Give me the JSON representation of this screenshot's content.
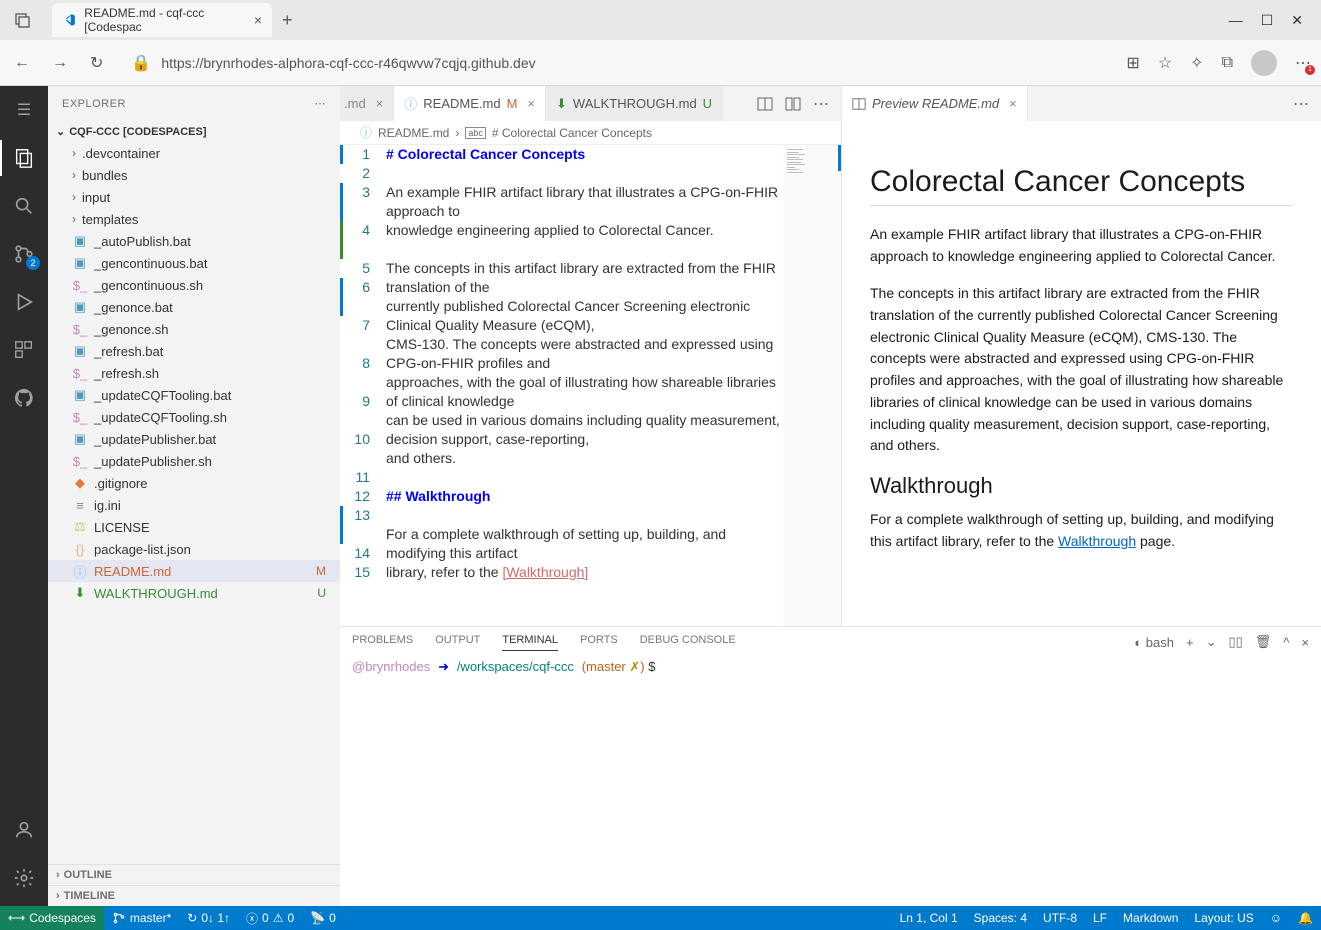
{
  "browser": {
    "tab_title": "README.md - cqf-ccc [Codespac",
    "url": "https://brynrhodes-alphora-cqf-ccc-r46qwvw7cqjq.github.dev",
    "more_badge": "1"
  },
  "explorer": {
    "title": "EXPLORER",
    "root": "CQF-CCC [CODESPACES]",
    "folders": [
      {
        "name": ".devcontainer"
      },
      {
        "name": "bundles"
      },
      {
        "name": "input"
      },
      {
        "name": "templates"
      }
    ],
    "files": [
      {
        "name": "_autoPublish.bat",
        "icon": "bat"
      },
      {
        "name": "_gencontinuous.bat",
        "icon": "bat"
      },
      {
        "name": "_gencontinuous.sh",
        "icon": "sh"
      },
      {
        "name": "_genonce.bat",
        "icon": "bat"
      },
      {
        "name": "_genonce.sh",
        "icon": "sh"
      },
      {
        "name": "_refresh.bat",
        "icon": "bat"
      },
      {
        "name": "_refresh.sh",
        "icon": "sh"
      },
      {
        "name": "_updateCQFTooling.bat",
        "icon": "bat"
      },
      {
        "name": "_updateCQFTooling.sh",
        "icon": "sh"
      },
      {
        "name": "_updatePublisher.bat",
        "icon": "bat"
      },
      {
        "name": "_updatePublisher.sh",
        "icon": "sh"
      },
      {
        "name": ".gitignore",
        "icon": "git"
      },
      {
        "name": "ig.ini",
        "icon": "ini"
      },
      {
        "name": "LICENSE",
        "icon": "license"
      },
      {
        "name": "package-list.json",
        "icon": "json"
      },
      {
        "name": "README.md",
        "icon": "info",
        "status": "M",
        "highlighted": true
      },
      {
        "name": "WALKTHROUGH.md",
        "icon": "walk",
        "status": "U"
      }
    ],
    "outline": "OUTLINE",
    "timeline": "TIMELINE"
  },
  "tabs": {
    "partial": ".md",
    "t1": {
      "label": "README.md",
      "mod": "M"
    },
    "t2": {
      "label": "WALKTHROUGH.md",
      "mod": "U"
    },
    "preview": {
      "label": "Preview README.md"
    }
  },
  "breadcrumb": {
    "file": "README.md",
    "section": "# Colorectal Cancer Concepts"
  },
  "editor_lines": [
    {
      "n": "1",
      "cls": "md-h1",
      "text": "# Colorectal Cancer Concepts",
      "mark": "changed"
    },
    {
      "n": "2",
      "text": ""
    },
    {
      "n": "3",
      "text": "An example FHIR artifact library that illustrates a CPG-on-FHIR approach to",
      "mark": "changed"
    },
    {
      "n": "4",
      "text": "knowledge engineering applied to Colorectal Cancer.",
      "mark": "added"
    },
    {
      "n": "5",
      "text": ""
    },
    {
      "n": "6",
      "text": "The concepts in this artifact library are extracted from the FHIR translation of the",
      "mark": "changed"
    },
    {
      "n": "7",
      "text": "currently published Colorectal Cancer Screening electronic Clinical Quality Measure (eCQM),"
    },
    {
      "n": "8",
      "text": "CMS-130. The concepts were abstracted and expressed using CPG-on-FHIR profiles and"
    },
    {
      "n": "9",
      "text": "approaches, with the goal of illustrating how shareable libraries of clinical knowledge"
    },
    {
      "n": "10",
      "text": "can be used in various domains including quality measurement, decision support, case-reporting,"
    },
    {
      "n": "11",
      "text": "and others."
    },
    {
      "n": "12",
      "text": ""
    },
    {
      "n": "13",
      "cls": "md-h2",
      "text": "## Walkthrough",
      "mark": "changed"
    },
    {
      "n": "14",
      "text": ""
    },
    {
      "n": "15",
      "text": "For a complete walkthrough of setting up, building, and modifying this artifact"
    },
    {
      "n": "",
      "text": "library, refer to the ",
      "link": "[Walkthrough]"
    }
  ],
  "preview": {
    "h1": "Colorectal Cancer Concepts",
    "p1": "An example FHIR artifact library that illustrates a CPG-on-FHIR approach to knowledge engineering applied to Colorectal Cancer.",
    "p2": "The concepts in this artifact library are extracted from the FHIR translation of the currently published Colorectal Cancer Screening electronic Clinical Quality Measure (eCQM), CMS-130. The concepts were abstracted and expressed using CPG-on-FHIR profiles and approaches, with the goal of illustrating how shareable libraries of clinical knowledge can be used in various domains including quality measurement, decision support, case-reporting, and others.",
    "h2": "Walkthrough",
    "p3a": "For a complete walkthrough of setting up, building, and modifying this artifact library, refer to the ",
    "p3link": "Walkthrough",
    "p3b": " page."
  },
  "panel": {
    "tabs": [
      "PROBLEMS",
      "OUTPUT",
      "TERMINAL",
      "PORTS",
      "DEBUG CONSOLE"
    ],
    "shell": "bash",
    "term": {
      "user": "@brynrhodes",
      "arrow": "➜",
      "path": "/workspaces/cqf-ccc",
      "branch_open": "(",
      "branch": "master",
      "x": " ✗",
      "branch_close": ")",
      "prompt": " $"
    }
  },
  "status": {
    "remote": "Codespaces",
    "branch": "master*",
    "sync": "0↓ 1↑",
    "errors": "0",
    "warnings": "0",
    "ports": "0",
    "ln": "Ln 1, Col 1",
    "spaces": "Spaces: 4",
    "encoding": "UTF-8",
    "eol": "LF",
    "lang": "Markdown",
    "layout": "Layout: US"
  },
  "activity_badge": "2"
}
